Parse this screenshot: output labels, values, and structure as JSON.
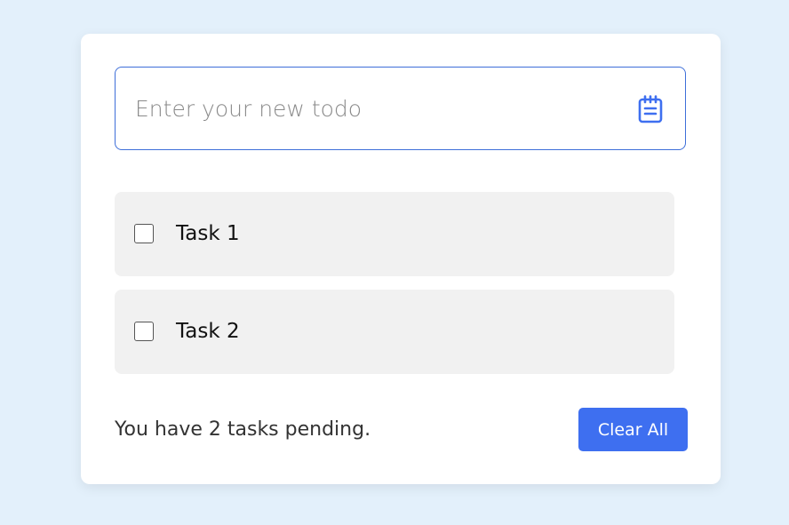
{
  "todo_input": {
    "placeholder": "Enter your new todo",
    "value": "",
    "icon": "notepad-icon"
  },
  "tasks": [
    {
      "label": "Task 1",
      "checked": false
    },
    {
      "label": "Task 2",
      "checked": false
    }
  ],
  "footer": {
    "pending_text": "You have 2 tasks pending.",
    "clear_label": "Clear All"
  },
  "colors": {
    "background": "#e3f0fb",
    "accent": "#3e6ff0",
    "task_bg": "#f1f1f1"
  }
}
